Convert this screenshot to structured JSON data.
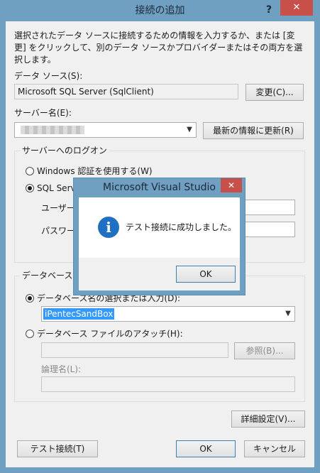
{
  "window": {
    "title": "接続の追加",
    "help_glyph": "?",
    "close_glyph": "✕"
  },
  "intro": "選択されたデータ ソースに接続するための情報を入力するか、または [変更] をクリックして、別のデータ ソースかプロバイダーまたはその両方を選択します。",
  "data_source": {
    "label": "データ ソース(S):",
    "value": "Microsoft SQL Server (SqlClient)",
    "change_button": "変更(C)..."
  },
  "server": {
    "label": "サーバー名(E):",
    "refresh_button": "最新の情報に更新(R)"
  },
  "logon": {
    "legend": "サーバーへのログオン",
    "windows_auth": "Windows 認証を使用する(W)",
    "sql_auth": "SQL Serv",
    "username_label": "ユーザー名",
    "password_label": "パスワード"
  },
  "database": {
    "legend": "データベースへの",
    "select_radio": "データベース名の選択または入力(D):",
    "db_value": "iPentecSandBox",
    "attach_radio": "データベース ファイルのアタッチ(H):",
    "browse_button": "参照(B)...",
    "logical_label": "論理名(L):"
  },
  "advanced_button": "詳細設定(V)...",
  "test_button": "テスト接続(T)",
  "ok_button": "OK",
  "cancel_button": "キャンセル",
  "message_box": {
    "title": "Microsoft Visual Studio",
    "close_glyph": "✕",
    "icon": "info-icon",
    "icon_glyph": "i",
    "message": "テスト接続に成功しました。",
    "ok_button": "OK"
  }
}
